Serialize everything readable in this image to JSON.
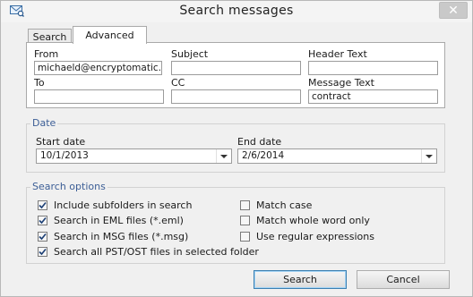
{
  "window": {
    "title": "Search messages",
    "close_glyph": "✕"
  },
  "tabs": [
    {
      "label": "Search",
      "active": false
    },
    {
      "label": "Advanced",
      "active": true
    }
  ],
  "fields": {
    "from": {
      "label": "From",
      "value": "michaeld@encryptomatic."
    },
    "subject": {
      "label": "Subject",
      "value": ""
    },
    "header_text": {
      "label": "Header Text",
      "value": ""
    },
    "to": {
      "label": "To",
      "value": ""
    },
    "cc": {
      "label": "CC",
      "value": ""
    },
    "message_text": {
      "label": "Message Text",
      "value": "contract"
    }
  },
  "date": {
    "group_title": "Date",
    "start_label": "Start date",
    "start_value": "10/1/2013",
    "end_label": "End date",
    "end_value": "2/6/2014"
  },
  "options": {
    "group_title": "Search options",
    "left": [
      {
        "label": "Include subfolders in search",
        "checked": true
      },
      {
        "label": "Search in EML files (*.eml)",
        "checked": true
      },
      {
        "label": "Search in MSG files (*.msg)",
        "checked": true
      },
      {
        "label": "Search all PST/OST files in selected folder",
        "checked": true
      }
    ],
    "right": [
      {
        "label": "Match case",
        "checked": false
      },
      {
        "label": "Match whole word only",
        "checked": false
      },
      {
        "label": "Use regular expressions",
        "checked": false
      }
    ]
  },
  "buttons": {
    "search": "Search",
    "cancel": "Cancel"
  },
  "colors": {
    "group_title": "#3c5e96",
    "primary_border": "#3c7fb1"
  }
}
